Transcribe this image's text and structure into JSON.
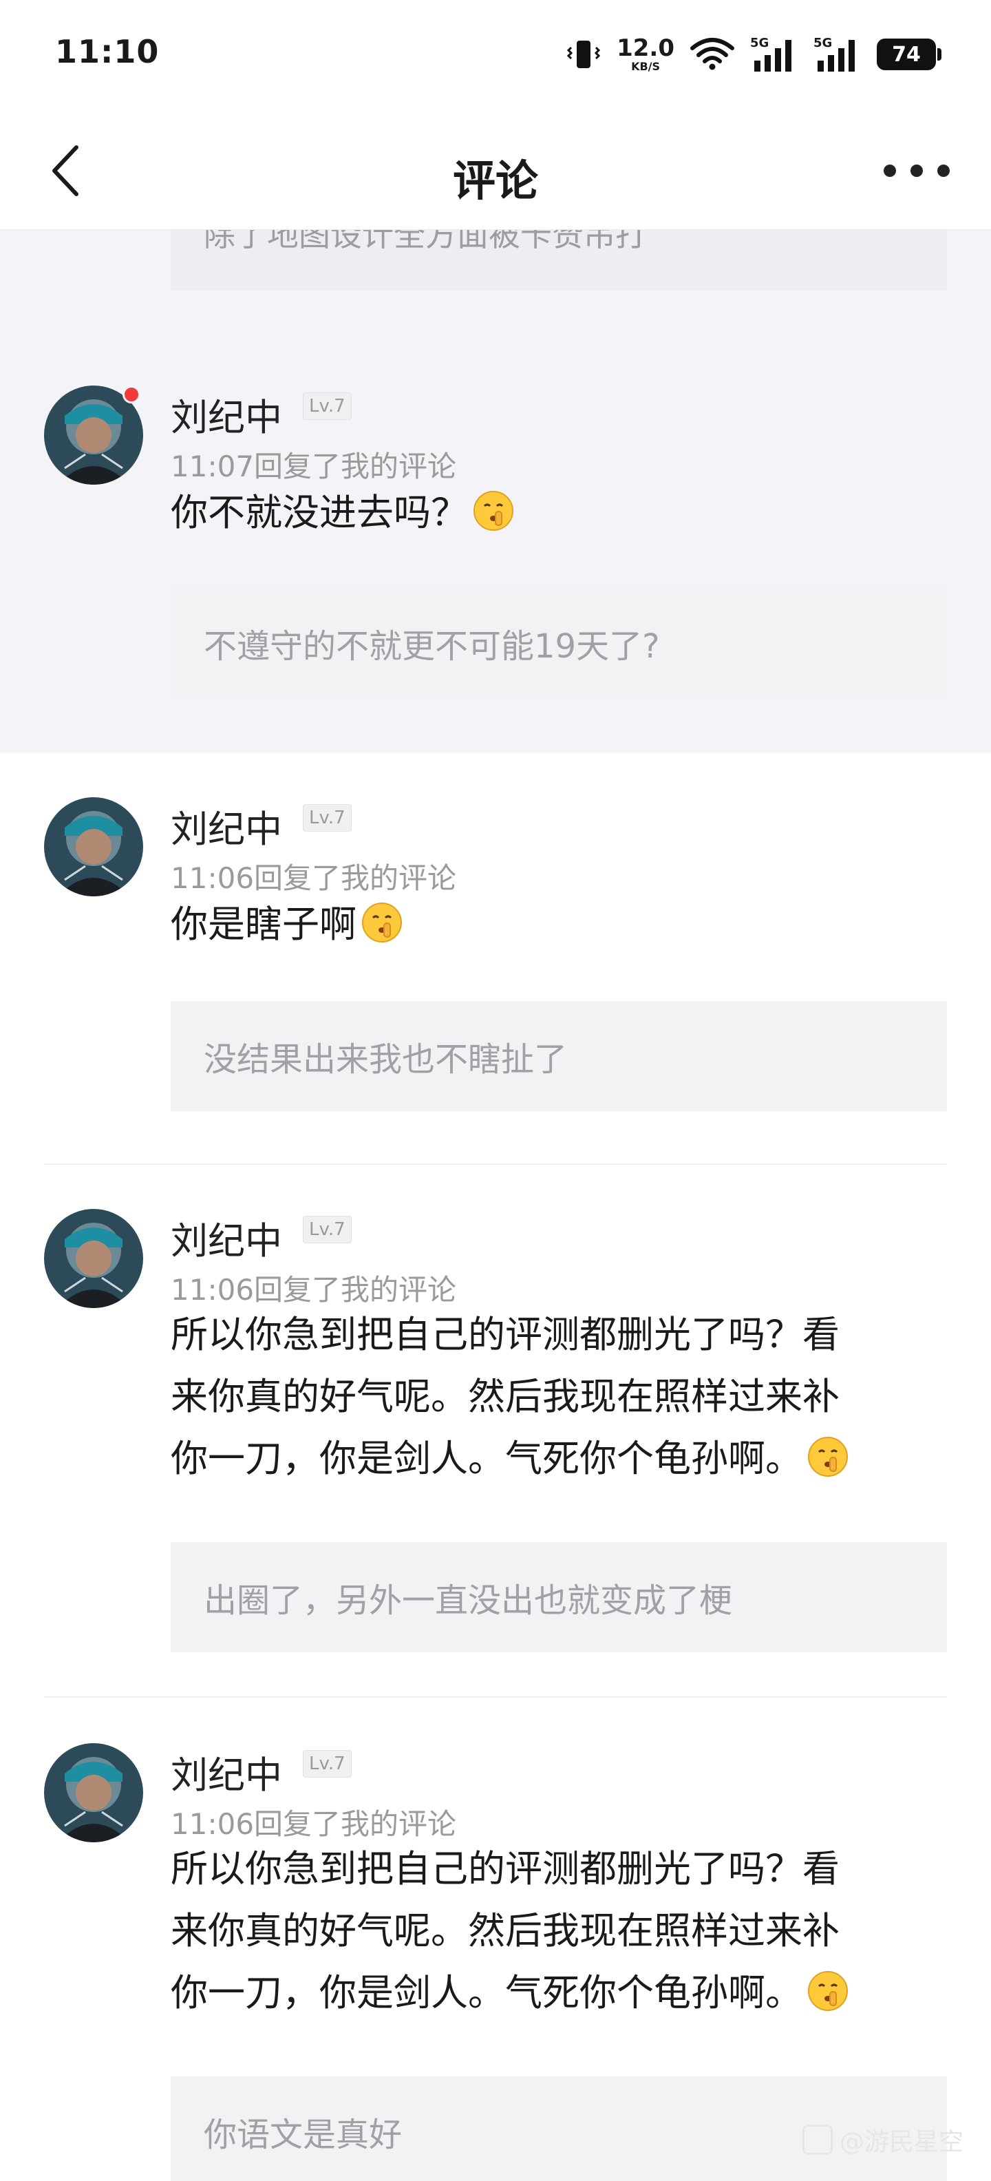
{
  "status_bar": {
    "time": "11:10",
    "net_speed_value": "12.0",
    "net_speed_unit": "KB/S",
    "signal_1_tag": "5G",
    "signal_2_tag": "5G",
    "battery": "74"
  },
  "nav": {
    "title": "评论",
    "back_icon": "chevron-left-icon",
    "more_icon": "more-dots-icon"
  },
  "partial_top": {
    "quote": "除了地图设计全方面被卡赞吊打"
  },
  "comments": [
    {
      "user": "刘纪中",
      "level": "Lv.7",
      "meta": "11:07回复了我的评论",
      "reply": "你不就没进去吗？",
      "quote": "不遵守的不就更不可能19天了?",
      "unread": true
    },
    {
      "user": "刘纪中",
      "level": "Lv.7",
      "meta": "11:06回复了我的评论",
      "reply": "你是瞎子啊",
      "quote": "没结果出来我也不瞎扯了",
      "unread": false
    },
    {
      "user": "刘纪中",
      "level": "Lv.7",
      "meta": "11:06回复了我的评论",
      "reply_lines": [
        "所以你急到把自己的评测都删光了吗？看",
        "来你真的好气呢。然后我现在照样过来补",
        "你一刀，你是剑人。气死你个龟孙啊。"
      ],
      "quote": "出圈了，另外一直没出也就变成了梗",
      "unread": false
    },
    {
      "user": "刘纪中",
      "level": "Lv.7",
      "meta": "11:06回复了我的评论",
      "reply_lines": [
        "所以你急到把自己的评测都删光了吗？看",
        "来你真的好气呢。然后我现在照样过来补",
        "你一刀，你是剑人。气死你个龟孙啊。"
      ],
      "quote": "你语文是真好",
      "unread": false
    }
  ],
  "watermark": "@游民星空"
}
